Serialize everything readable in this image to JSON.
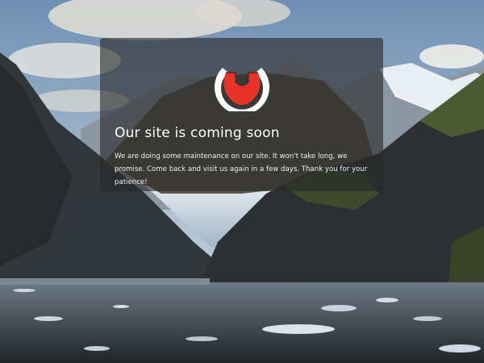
{
  "page": {
    "title": "Our site is coming soon",
    "message": "We are doing some maintenance on our site. It won't take long, we promise. Come back and visit us again in a few days. Thank you for your patience!"
  },
  "logo": {
    "icon": "wrench-logo-icon",
    "color": "#e8332a",
    "ring_color": "#ffffff"
  },
  "background": {
    "description_colors": {
      "sky": "#8aa4c0",
      "clouds": "#e8e6e0",
      "mountain_dark": "#2f3336",
      "forest": "#3d4a2a",
      "glacier": "#c9d6e2",
      "water": "#4a5158"
    }
  }
}
